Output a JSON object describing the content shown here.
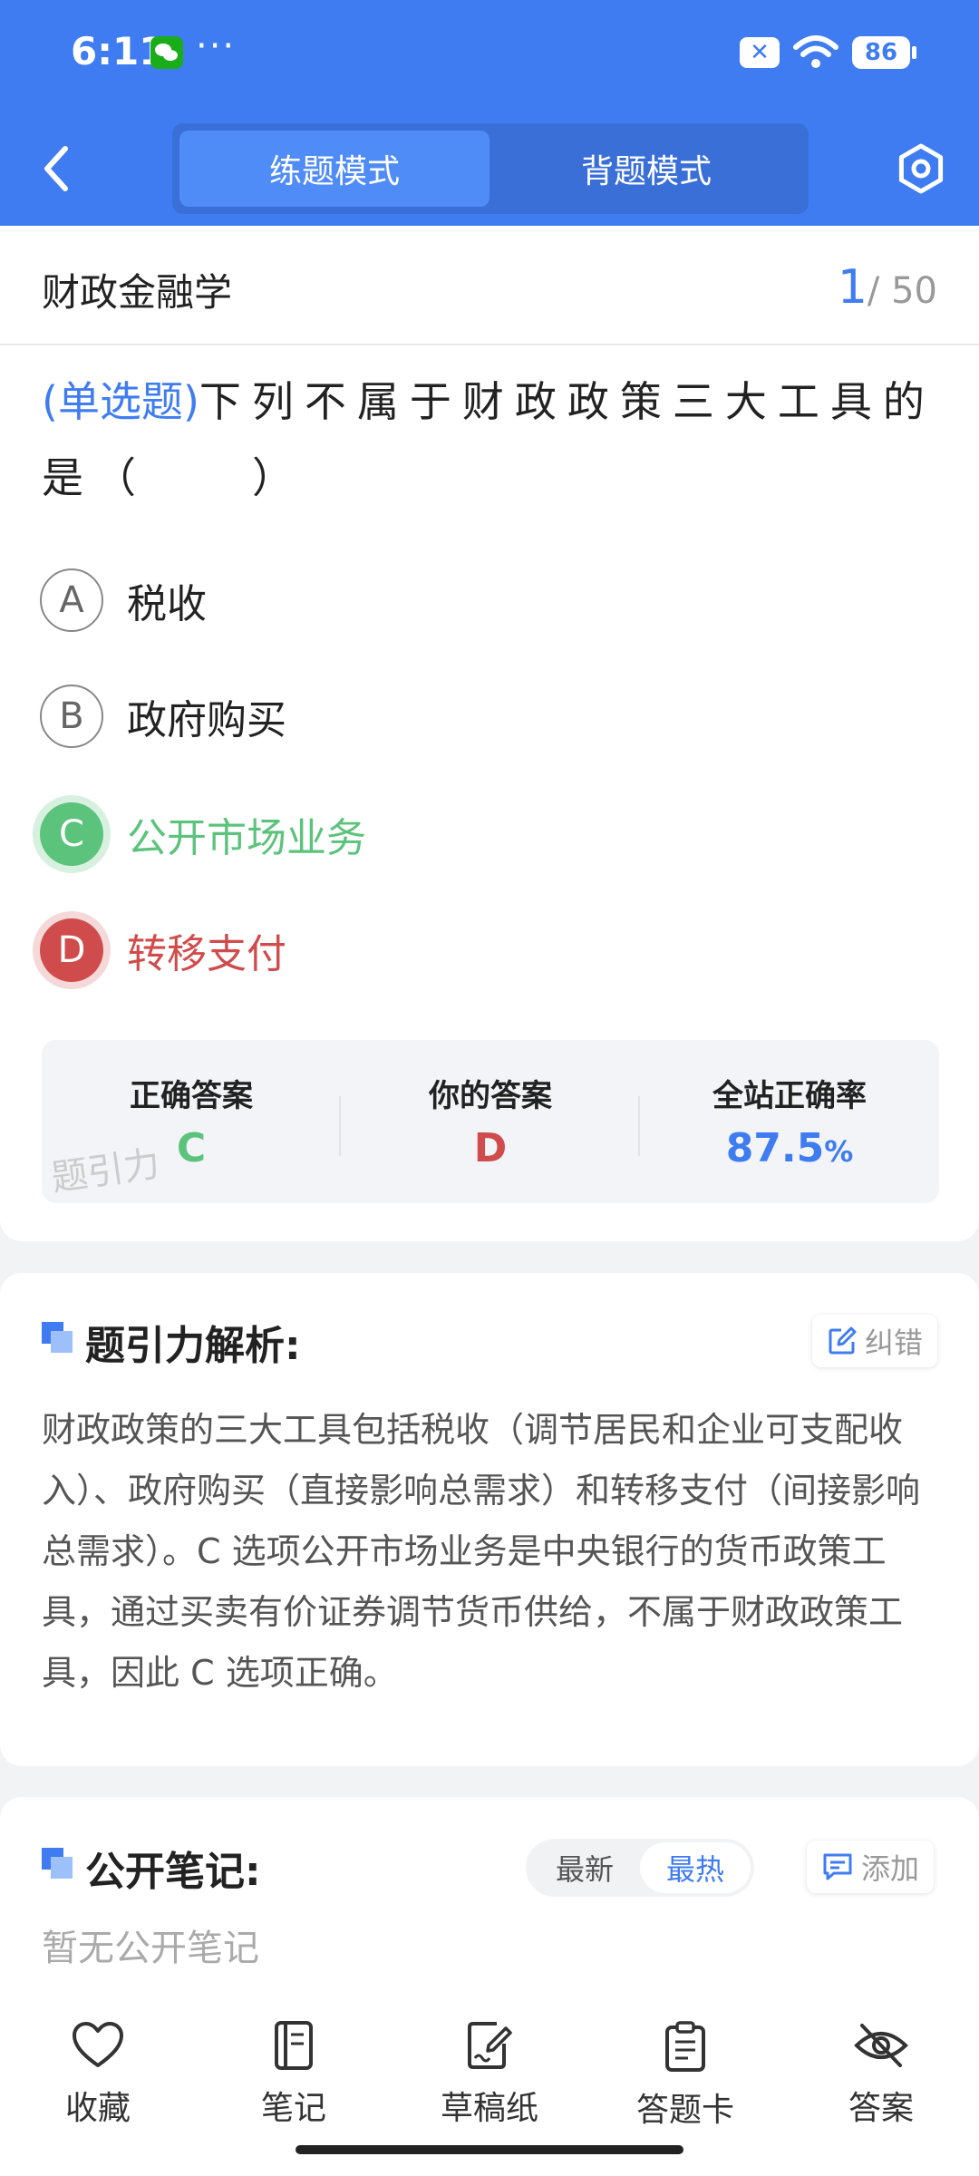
{
  "status_bar": {
    "time": "6:11",
    "dots": "···",
    "x_badge": "✕",
    "battery": "86"
  },
  "header": {
    "tabs": [
      {
        "label": "练题模式",
        "active": true
      },
      {
        "label": "背题模式",
        "active": false
      }
    ]
  },
  "question_card": {
    "subject": "财政金融学",
    "progress_current": "1",
    "progress_total": "/ 50",
    "question_type": "(单选题)",
    "question_text": "下列不属于财政政策三大工具的是（　　）",
    "options": [
      {
        "letter": "A",
        "text": "税收",
        "state": "normal"
      },
      {
        "letter": "B",
        "text": "政府购买",
        "state": "normal"
      },
      {
        "letter": "C",
        "text": "公开市场业务",
        "state": "correct"
      },
      {
        "letter": "D",
        "text": "转移支付",
        "state": "wrong"
      }
    ],
    "answer_box": {
      "correct_label": "正确答案",
      "correct_value": "C",
      "your_label": "你的答案",
      "your_value": "D",
      "rate_label": "全站正确率",
      "rate_value": "87.5",
      "rate_unit": "%",
      "watermark": "题引力"
    }
  },
  "explanation": {
    "title": "题引力解析:",
    "correct_button": "纠错",
    "text": "财政政策的三大工具包括税收（调节居民和企业可支配收入）、政府购买（直接影响总需求）和转移支付（间接影响总需求）。C 选项公开市场业务是中央银行的货币政策工具，通过买卖有价证券调节货币供给，不属于财政政策工具，因此 C 选项正确。"
  },
  "notes": {
    "title": "公开笔记:",
    "sort_options": [
      {
        "label": "最新",
        "active": false
      },
      {
        "label": "最热",
        "active": true
      }
    ],
    "add_button": "添加",
    "empty_text": "暂无公开笔记"
  },
  "bottom_nav": [
    {
      "label": "收藏",
      "icon": "heart-icon"
    },
    {
      "label": "笔记",
      "icon": "notebook-icon"
    },
    {
      "label": "草稿纸",
      "icon": "draft-icon"
    },
    {
      "label": "答题卡",
      "icon": "answer-sheet-icon"
    },
    {
      "label": "答案",
      "icon": "eye-off-icon"
    }
  ],
  "colors": {
    "accent": "#3f7cf2",
    "correct": "#5cc37c",
    "wrong": "#d04c4c"
  }
}
